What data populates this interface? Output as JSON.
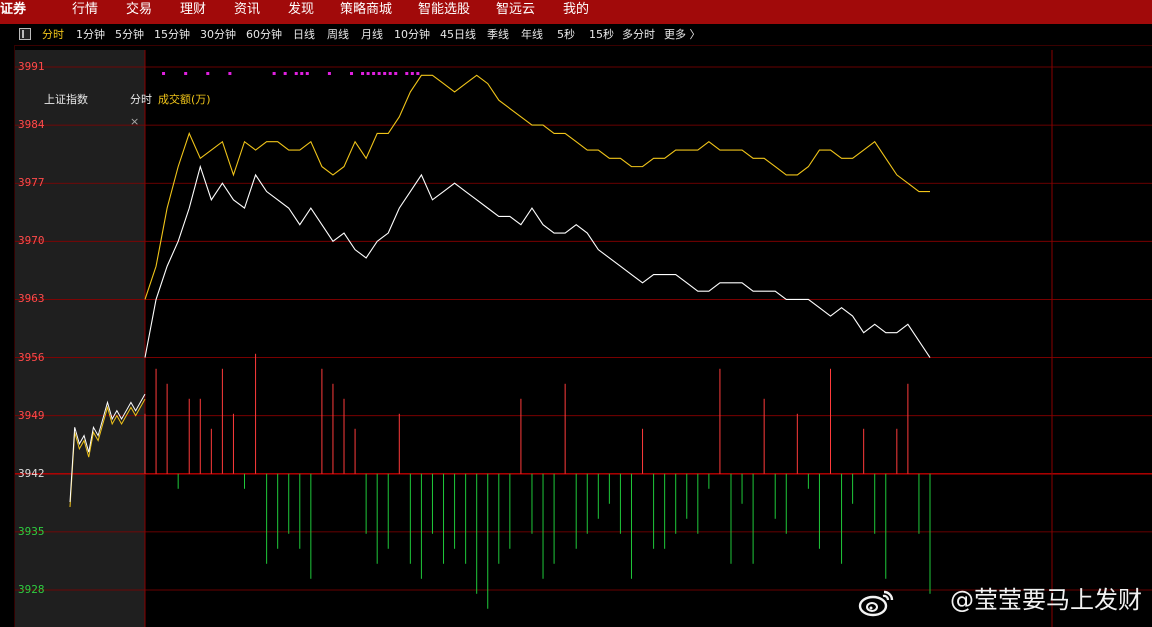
{
  "topnav": {
    "brand": "证券",
    "items": [
      "行情",
      "交易",
      "理财",
      "资讯",
      "发现",
      "策略商城",
      "智能选股",
      "智远云",
      "我的"
    ]
  },
  "toolbar": {
    "items": [
      "分时",
      "1分钟",
      "5分钟",
      "15分钟",
      "30分钟",
      "60分钟",
      "日线",
      "周线",
      "月线",
      "10分钟",
      "45日线",
      "季线",
      "年线",
      "5秒",
      "15秒",
      "多分时",
      "更多 〉"
    ],
    "active": "分时"
  },
  "legend": {
    "index_name": "上证指数",
    "mode": "分时",
    "volume_label": "成交额(万)"
  },
  "close_glyph": "×",
  "colors": {
    "price_line": "#ffffff",
    "avg_line": "#f0c419",
    "up": "#ff3b3b",
    "down": "#1fc93a",
    "axis_red": "#ff4a4a",
    "axis_green": "#2ecc40",
    "grid": "#8a0000",
    "marker": "#e020e0"
  },
  "watermark": "@莹莹要马上发财",
  "watermark_icon": "weibo-icon",
  "chart_data": {
    "type": "line",
    "title": "上证指数",
    "ylabels": [
      "3991",
      "3984",
      "3977",
      "3970",
      "3963",
      "3956",
      "3949",
      "3942",
      "3935",
      "3928"
    ],
    "ylim": [
      3928,
      3991
    ],
    "base": 3942,
    "pre_market": [
      3938,
      3947,
      3945,
      3946,
      3944,
      3947,
      3946,
      3948,
      3950,
      3948,
      3949,
      3948,
      3949,
      3950,
      3949,
      3950,
      3951
    ],
    "series": [
      {
        "values": [
          3956,
          3963,
          3967,
          3970,
          3974,
          3979,
          3975,
          3977,
          3975,
          3974,
          3978,
          3976,
          3975,
          3974,
          3972,
          3974,
          3972,
          3970,
          3971,
          3969,
          3968,
          3970,
          3971,
          3974,
          3976,
          3978,
          3975,
          3976,
          3977,
          3976,
          3975,
          3974,
          3973,
          3973,
          3972,
          3974,
          3972,
          3971,
          3971,
          3972,
          3971,
          3969,
          3968,
          3967,
          3966,
          3965,
          3966,
          3966,
          3966,
          3965,
          3964,
          3964,
          3965,
          3965,
          3965,
          3964,
          3964,
          3964,
          3963,
          3963,
          3963,
          3962,
          3961,
          3962,
          3961,
          3959,
          3960,
          3959,
          3959,
          3960,
          3958,
          3956
        ]
      },
      {
        "values": [
          3963,
          3967,
          3974,
          3979,
          3983,
          3980,
          3981,
          3982,
          3978,
          3982,
          3981,
          3982,
          3982,
          3981,
          3981,
          3982,
          3979,
          3978,
          3979,
          3982,
          3980,
          3983,
          3983,
          3985,
          3988,
          3990,
          3990,
          3989,
          3988,
          3989,
          3990,
          3989,
          3987,
          3986,
          3985,
          3984,
          3984,
          3983,
          3983,
          3982,
          3981,
          3981,
          3980,
          3980,
          3979,
          3979,
          3980,
          3980,
          3981,
          3981,
          3981,
          3982,
          3981,
          3981,
          3981,
          3980,
          3980,
          3979,
          3978,
          3978,
          3979,
          3981,
          3981,
          3980,
          3980,
          3981,
          3982,
          3980,
          3978,
          3977,
          3976,
          3976
        ]
      }
    ],
    "volume": [
      4,
      7,
      6,
      -1,
      5,
      5,
      3,
      7,
      4,
      -1,
      8,
      -6,
      -5,
      -4,
      -5,
      -7,
      7,
      6,
      5,
      3,
      -4,
      -6,
      -5,
      4,
      -6,
      -7,
      -4,
      -6,
      -5,
      -6,
      -8,
      -9,
      -6,
      -5,
      5,
      -4,
      -7,
      -6,
      6,
      -5,
      -4,
      -3,
      -2,
      -4,
      -7,
      3,
      -5,
      -5,
      -4,
      -3,
      -4,
      -1,
      7,
      -6,
      -2,
      -6,
      5,
      -3,
      -4,
      4,
      -1,
      -5,
      7,
      -6,
      -2,
      3,
      -4,
      -7,
      3,
      6,
      -4,
      -8
    ],
    "markers": [
      1,
      3,
      5,
      7,
      11,
      12,
      13,
      13.5,
      14,
      16,
      18,
      19,
      19.5,
      20,
      20.5,
      21,
      21.5,
      22,
      23,
      23.5,
      24
    ]
  }
}
